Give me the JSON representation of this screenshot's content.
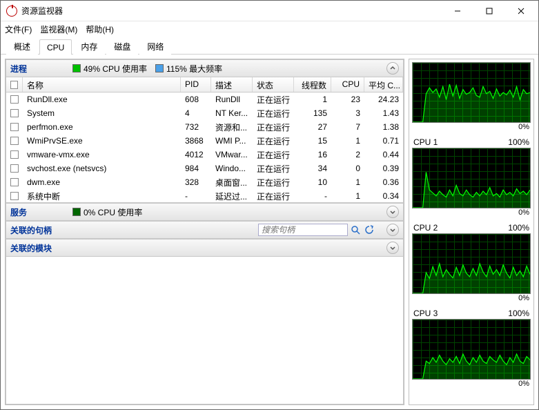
{
  "window": {
    "title": "资源监视器"
  },
  "menu": {
    "file": "文件(F)",
    "monitor": "监视器(M)",
    "help": "帮助(H)"
  },
  "tabs": {
    "overview": "概述",
    "cpu": "CPU",
    "memory": "内存",
    "disk": "磁盘",
    "network": "网络"
  },
  "sections": {
    "processes": {
      "title": "进程",
      "cpu_usage": "49% CPU 使用率",
      "max_freq": "115% 最大频率",
      "columns": {
        "name": "名称",
        "pid": "PID",
        "desc": "描述",
        "state": "状态",
        "threads": "线程数",
        "cpu": "CPU",
        "avg_cpu": "平均 C..."
      },
      "rows": [
        {
          "name": "RunDll.exe",
          "pid": "608",
          "desc": "RunDll",
          "state": "正在运行",
          "threads": "1",
          "cpu": "23",
          "avg": "24.23"
        },
        {
          "name": "System",
          "pid": "4",
          "desc": "NT Ker...",
          "state": "正在运行",
          "threads": "135",
          "cpu": "3",
          "avg": "1.43"
        },
        {
          "name": "perfmon.exe",
          "pid": "732",
          "desc": "资源和...",
          "state": "正在运行",
          "threads": "27",
          "cpu": "7",
          "avg": "1.38"
        },
        {
          "name": "WmiPrvSE.exe",
          "pid": "3868",
          "desc": "WMI P...",
          "state": "正在运行",
          "threads": "15",
          "cpu": "1",
          "avg": "0.71"
        },
        {
          "name": "vmware-vmx.exe",
          "pid": "4012",
          "desc": "VMwar...",
          "state": "正在运行",
          "threads": "16",
          "cpu": "2",
          "avg": "0.44"
        },
        {
          "name": "svchost.exe (netsvcs)",
          "pid": "984",
          "desc": "Windo...",
          "state": "正在运行",
          "threads": "34",
          "cpu": "0",
          "avg": "0.39"
        },
        {
          "name": "dwm.exe",
          "pid": "328",
          "desc": "桌面窗...",
          "state": "正在运行",
          "threads": "10",
          "cpu": "1",
          "avg": "0.36"
        },
        {
          "name": "系统中断",
          "pid": "-",
          "desc": "延迟过...",
          "state": "正在运行",
          "threads": "-",
          "cpu": "1",
          "avg": "0.34"
        }
      ]
    },
    "services": {
      "title": "服务",
      "cpu_usage": "0% CPU 使用率"
    },
    "handles": {
      "title": "关联的句柄",
      "search_placeholder": "搜索句柄"
    },
    "modules": {
      "title": "关联的模块"
    }
  },
  "graphs": {
    "zero": "0%",
    "hundred": "100%",
    "items": [
      {
        "label": ""
      },
      {
        "label": "CPU 1"
      },
      {
        "label": "CPU 2"
      },
      {
        "label": "CPU 3"
      }
    ]
  },
  "chart_data": [
    {
      "type": "area",
      "title": "CPU 总计",
      "ylim": [
        0,
        100
      ],
      "xlabel": "",
      "ylabel": "%",
      "values": [
        0,
        0,
        0,
        0,
        48,
        58,
        50,
        56,
        42,
        60,
        38,
        64,
        44,
        62,
        40,
        55,
        47,
        50,
        58,
        45,
        42,
        60,
        48,
        52,
        40,
        56,
        44,
        50,
        46,
        54,
        42,
        60,
        38,
        55,
        48,
        50
      ]
    },
    {
      "type": "area",
      "title": "CPU 1",
      "ylim": [
        0,
        100
      ],
      "xlabel": "",
      "ylabel": "%",
      "values": [
        0,
        0,
        0,
        0,
        60,
        30,
        25,
        20,
        28,
        22,
        18,
        30,
        20,
        38,
        24,
        20,
        30,
        22,
        18,
        26,
        20,
        28,
        22,
        34,
        20,
        24,
        18,
        30,
        22,
        26,
        20,
        32,
        24,
        28,
        22,
        30
      ]
    },
    {
      "type": "area",
      "title": "CPU 2",
      "ylim": [
        0,
        100
      ],
      "xlabel": "",
      "ylabel": "%",
      "values": [
        0,
        0,
        0,
        0,
        35,
        25,
        45,
        30,
        50,
        28,
        40,
        32,
        26,
        44,
        30,
        48,
        34,
        28,
        42,
        30,
        50,
        36,
        28,
        46,
        32,
        40,
        30,
        48,
        34,
        26,
        44,
        30,
        38,
        28,
        46,
        32
      ]
    },
    {
      "type": "area",
      "title": "CPU 3",
      "ylim": [
        0,
        100
      ],
      "xlabel": "",
      "ylabel": "%",
      "values": [
        0,
        0,
        0,
        0,
        30,
        26,
        36,
        28,
        40,
        30,
        24,
        34,
        28,
        38,
        26,
        42,
        30,
        24,
        36,
        28,
        40,
        30,
        26,
        38,
        32,
        28,
        40,
        30,
        24,
        36,
        28,
        42,
        30,
        26,
        38,
        32
      ]
    }
  ]
}
